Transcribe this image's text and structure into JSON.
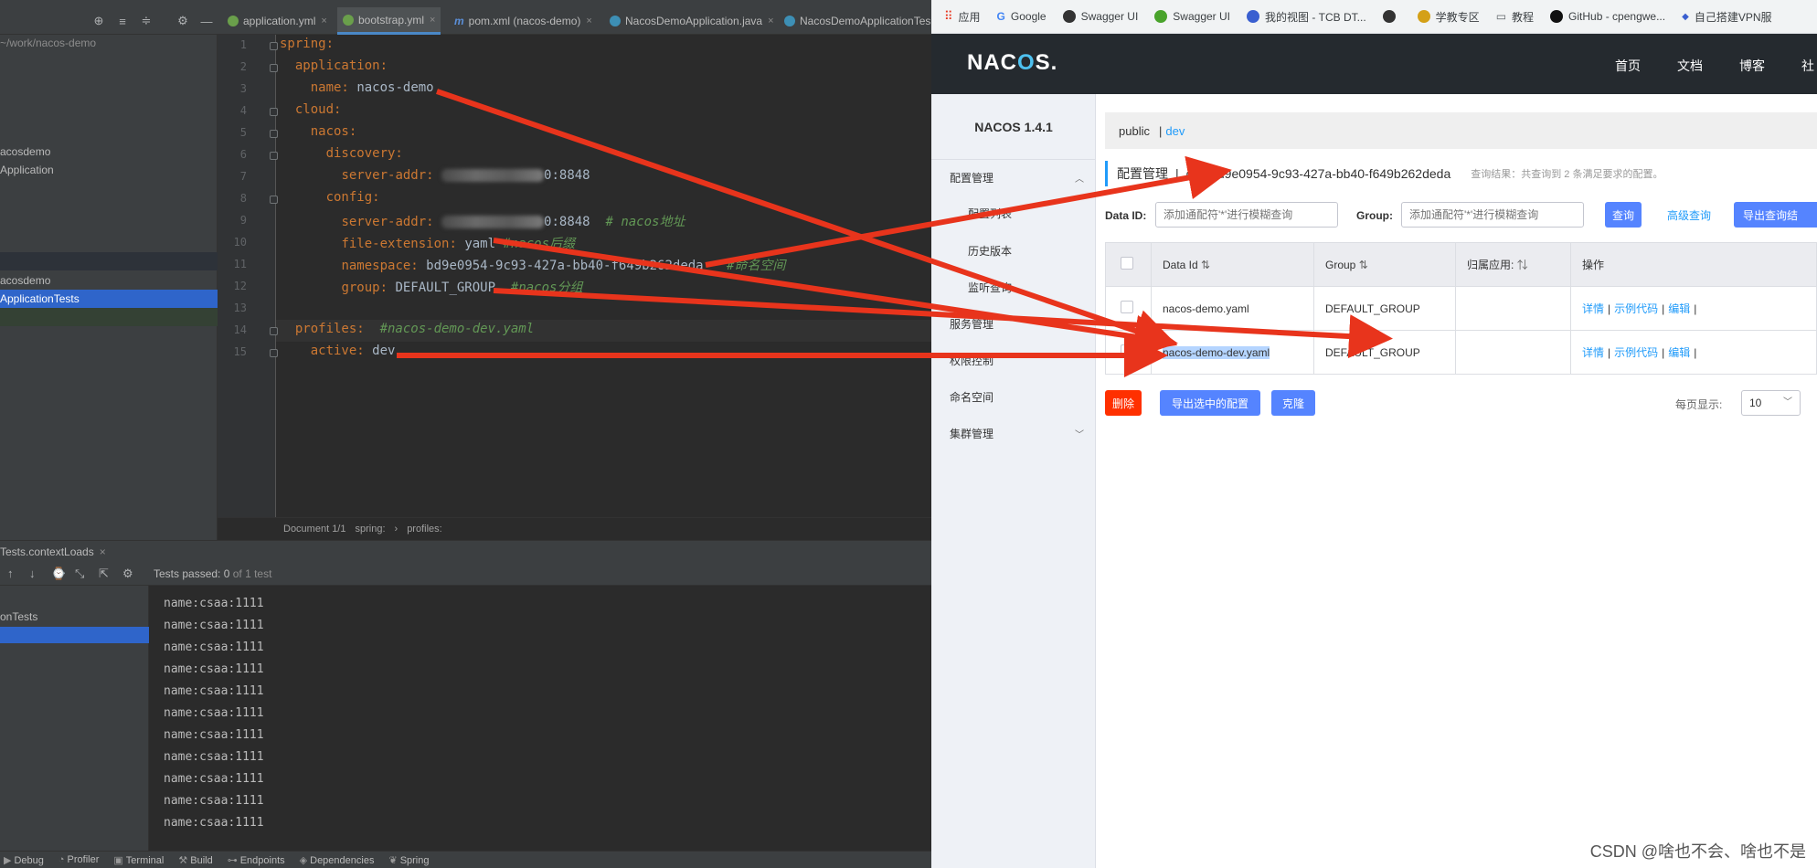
{
  "ide": {
    "tabs": [
      {
        "label": "application.yml"
      },
      {
        "label": "bootstrap.yml"
      },
      {
        "label": "pom.xml (nacos-demo)"
      },
      {
        "label": "NacosDemoApplication.java"
      },
      {
        "label": "NacosDemoApplicationTes"
      }
    ],
    "project": {
      "path": "~/work/nacos-demo",
      "items": [
        "acosdemo",
        "Application",
        "acosdemo",
        "ApplicationTests"
      ]
    },
    "code": {
      "lines": [
        "1",
        "2",
        "3",
        "4",
        "5",
        "6",
        "7",
        "8",
        "9",
        "10",
        "11",
        "12",
        "13",
        "14",
        "15"
      ],
      "spring": "spring:",
      "application": "application:",
      "name_key": "name:",
      "name_val": "nacos-demo",
      "cloud": "cloud:",
      "nacos": "nacos:",
      "discovery": "discovery:",
      "server_addr_key": "server-addr:",
      "disc_port": "0:8848",
      "config": "config:",
      "cfg_port": "0:8848",
      "cfg_comment": "# nacos地址",
      "file_ext_key": "file-extension:",
      "file_ext_val": "yaml",
      "file_ext_comment": "#nacos后缀",
      "namespace_key": "namespace:",
      "namespace_val": "bd9e0954-9c93-427a-bb40-f649b262deda",
      "namespace_comment": "#命名空间",
      "group_key": "group:",
      "group_val": "DEFAULT_GROUP",
      "group_comment": "#nacos分组",
      "profiles_key": "profiles:",
      "profiles_comment": "#nacos-demo-dev.yaml",
      "active_key": "active:",
      "active_val": "dev"
    },
    "breadcrumb": [
      "Document 1/1",
      "spring:",
      "profiles:"
    ],
    "run": {
      "tab": "Tests.contextLoads",
      "tests_passed_label": "Tests passed:",
      "tests_passed_value": "0",
      "tests_passed_of": "of 1 test",
      "tree_item": "onTests",
      "console_lines": [
        "name:csaa:1111",
        "name:csaa:1111",
        "name:csaa:1111",
        "name:csaa:1111",
        "name:csaa:1111",
        "name:csaa:1111",
        "name:csaa:1111",
        "name:csaa:1111",
        "name:csaa:1111",
        "name:csaa:1111",
        "name:csaa:1111"
      ]
    },
    "statusbar": [
      "Debug",
      "Profiler",
      "Terminal",
      "Build",
      "Endpoints",
      "Dependencies",
      "Spring"
    ]
  },
  "browser": {
    "bookmarks": [
      "应用",
      "Google",
      "Swagger UI",
      "Swagger UI",
      "我的视图 - TCB DT...",
      "",
      "学教专区",
      "教程",
      "GitHub - cpengwe...",
      "自己搭建VPN服"
    ],
    "logo": {
      "pre": "NAC",
      "o": "O",
      "post": "S."
    },
    "topnav": [
      "首页",
      "文档",
      "博客",
      "社"
    ],
    "version": "NACOS 1.4.1",
    "sidebar": {
      "config_mgmt": "配置管理",
      "sub_items": [
        "配置列表",
        "历史版本",
        "监听查询"
      ],
      "service_mgmt": "服务管理",
      "permission": "权限控制",
      "namespace": "命名空间",
      "cluster": "集群管理"
    },
    "ns_bar": {
      "public": "public",
      "sep": "|",
      "dev": "dev"
    },
    "title": {
      "label": "配置管理",
      "sep": "|",
      "ns_id": "dev bd9e0954-9c93-427a-bb40-f649b262deda",
      "result": "查询结果：共查询到 2 条满足要求的配置。"
    },
    "search": {
      "dataid_label": "Data ID:",
      "dataid_placeholder": "添加通配符'*'进行模糊查询",
      "group_label": "Group:",
      "group_placeholder": "添加通配符'*'进行模糊查询",
      "query_btn": "查询",
      "advanced_btn": "高级查询",
      "export_btn": "导出查询结"
    },
    "table": {
      "headers": [
        "Data Id",
        "Group",
        "归属应用:",
        "操作"
      ],
      "rows": [
        {
          "data_id": "nacos-demo.yaml",
          "group": "DEFAULT_GROUP",
          "app": ""
        },
        {
          "data_id": "nacos-demo-dev.yaml",
          "group": "DEFAULT_GROUP",
          "app": ""
        }
      ],
      "ops": [
        "详情",
        "示例代码",
        "编辑"
      ]
    },
    "bottom": {
      "delete_btn": "删除",
      "export_selected_btn": "导出选中的配置",
      "clone_btn": "克隆",
      "page_size_label": "每页显示:",
      "page_size": "10"
    },
    "watermark": "CSDN @啥也不会、啥也不是"
  },
  "colors": {
    "arrow": "#e8341c",
    "accent": "#209bfa",
    "primary_btn": "#5584ff"
  }
}
